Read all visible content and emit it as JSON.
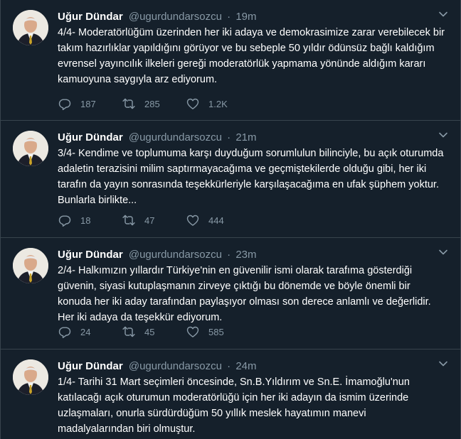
{
  "user": {
    "name": "Uğur Dündar",
    "handle": "@ugurdundarsozcu",
    "separator": "·"
  },
  "tweets": [
    {
      "time": "19m",
      "text": "4/4- Moderatörlüğüm üzerinden her iki adaya ve demokrasimize zarar verebilecek bir takım hazırlıklar yapıldığını görüyor ve bu sebeple 50 yıldır ödünsüz bağlı kaldığım evrensel yayıncılık ilkeleri gereği moderatörlük yapmama yönünde aldığım kararı kamuoyuna saygıyla arz ediyorum.",
      "replies": "187",
      "retweets": "285",
      "likes": "1.2K"
    },
    {
      "time": "21m",
      "text": "3/4- Kendime ve toplumuma karşı duyduğum sorumlulun bilinciyle, bu açık oturumda adaletin terazisini milim saptırmayacağıma ve geçmiştekilerde olduğu gibi, her iki tarafın da yayın sonrasında teşekkürleriyle karşılaşacağıma en ufak şüphem yoktur. Bunlarla birlikte...",
      "replies": "18",
      "retweets": "47",
      "likes": "444"
    },
    {
      "time": "23m",
      "text": "2/4- Halkımızın yıllardır Türkiye'nin en güvenilir ismi olarak tarafıma gösterdiği güvenin, siyasi kutuplaşmanın zirveye çıktığı bu dönemde ve böyle önemli bir konuda her iki aday tarafından paylaşıyor olması son derece anlamlı ve değerlidir. Her iki adaya da teşekkür ediyorum.",
      "replies": "24",
      "retweets": "45",
      "likes": "585"
    },
    {
      "time": "24m",
      "text": "1/4- Tarihi 31 Mart seçimleri öncesinde, Sn.B.Yıldırım ve Sn.E. İmamoğlu'nun katılacağı açık oturumun moderatörlüğü için her iki adayın da ismim üzerinde uzlaşmaları, onurla sürdürdüğüm 50 yıllık meslek hayatımın manevi madalyalarından biri olmuştur."
    }
  ],
  "icons": {
    "reply": "reply-icon",
    "retweet": "retweet-icon",
    "like": "heart-icon",
    "caret": "chevron-down-icon"
  },
  "colors": {
    "background": "#15202b",
    "border": "#38444d",
    "muted": "#8899a6",
    "text": "#ffffff"
  }
}
